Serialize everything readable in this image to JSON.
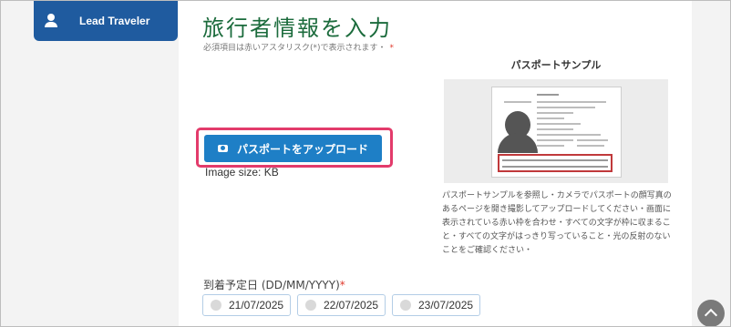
{
  "sidebar": {
    "lead_traveler_label": "Lead Traveler"
  },
  "form": {
    "title": "旅行者情報を入力",
    "required_note": "必須項目は赤いアスタリスク(*)で表示されます・",
    "required_star": "*",
    "upload_button_label": "パスポートをアップロード",
    "image_size_label": "Image size: KB",
    "arrival_label": "到着予定日 (DD/MM/YYYY)",
    "arrival_required_star": "*",
    "date_options": [
      "21/07/2025",
      "22/07/2025",
      "23/07/2025"
    ]
  },
  "sample": {
    "title": "パスポートサンプル",
    "instructions": "パスポートサンプルを参照し・カメラでパスポートの顔写真のあるページを開き撮影してアップロードしてください・画面に表示されている赤い枠を合わせ・すべての文字が枠に収まること・すべての文字がはっきり写っていること・光の反射のないことをご確認ください・"
  },
  "colors": {
    "title_green": "#1b6b3c",
    "button_blue": "#1e7fc6",
    "highlight_pink": "#e33b6b",
    "tab_blue": "#1f5b9f",
    "required_red": "#e0392c"
  },
  "icons": [
    "user-icon",
    "camera-icon",
    "scroll-top-icon",
    "radio-icon"
  ]
}
